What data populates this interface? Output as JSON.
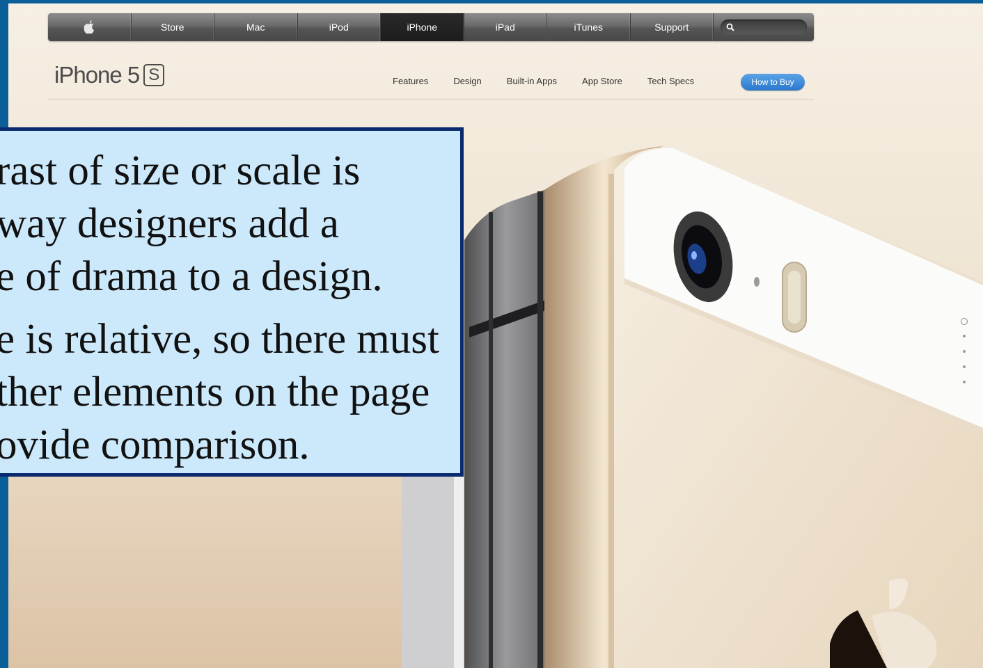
{
  "globalnav": {
    "items": [
      "Store",
      "Mac",
      "iPod",
      "iPhone",
      "iPad",
      "iTunes",
      "Support"
    ],
    "active": "iPhone"
  },
  "product": {
    "title": "iPhone 5",
    "badge": "S"
  },
  "subnav": {
    "items": [
      "Features",
      "Design",
      "Built-in Apps",
      "App Store",
      "Tech Specs"
    ],
    "buy_label": "How to Buy"
  },
  "callout": {
    "paragraph1": "rast of size or scale is\nway designers add a\ne of drama to a design.",
    "paragraph2": "e is relative, so there must\nther elements on the page\novide comparison."
  },
  "colors": {
    "slide_border": "#0b5f99",
    "callout_bg": "#cce9fb",
    "callout_border": "#0b2a6e",
    "buy_button": "#2a78cd"
  }
}
